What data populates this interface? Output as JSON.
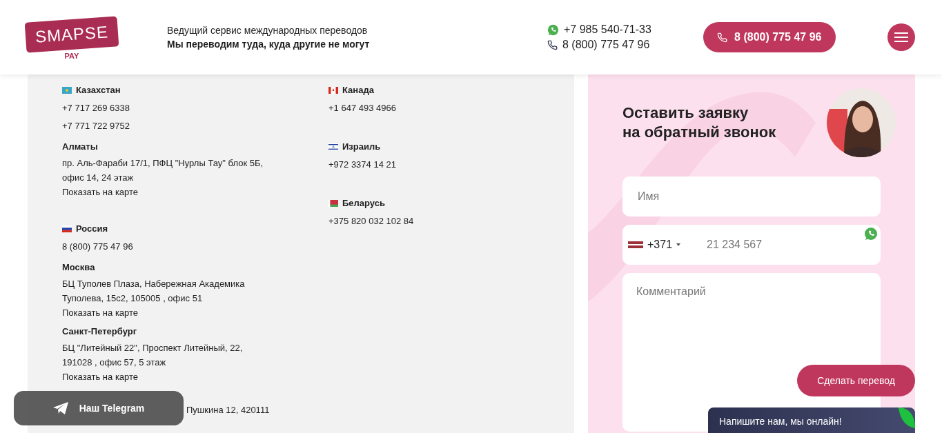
{
  "header": {
    "logo": {
      "name": "SMAPSE",
      "sub": "PAY"
    },
    "tagline": "Ведущий сервис международных переводов",
    "slogan": "Мы переводим туда, куда другие не могут",
    "phones": [
      {
        "kind": "whatsapp",
        "number": "+7 985 540-71-33"
      },
      {
        "kind": "phone",
        "number": "8 (800) 775 47 96"
      }
    ],
    "call_button": "8 (800) 775 47 96"
  },
  "contacts": [
    [
      {
        "kind": "kz",
        "country": "Казахстан",
        "phones": [
          "+7 717 269 6338",
          "+7 771 722 9752"
        ],
        "cities": [
          {
            "name": "Алматы",
            "address": "пр. Аль-Фараби 17/1, ПФЦ \"Нурлы Тау\" блок 5Б, офис 14, 24 этаж",
            "map_link": "Показать на карте"
          }
        ]
      },
      {
        "kind": "ru",
        "country": "Россия",
        "phones": [
          "8 (800) 775 47 96"
        ],
        "cities": [
          {
            "name": "Москва",
            "address": "БЦ Туполев Плаза, Набережная Академика Туполева, 15с2, 105005 , офис 51",
            "map_link": "Показать на карте"
          },
          {
            "name": "Санкт-Петербург",
            "address": "БЦ \"Литейный 22\", Проспект Литейный, 22, 191028 , офис 57, 5 этаж",
            "map_link": "Показать на карте"
          }
        ]
      }
    ],
    [
      {
        "kind": "ca",
        "country": "Канада",
        "phones": [
          "+1 647 493 4966"
        ]
      },
      {
        "kind": "il",
        "country": "Израиль",
        "phones": [
          "+972 3374 14 21"
        ]
      },
      {
        "kind": "by",
        "country": "Беларусь",
        "phones": [
          "+375 820 032 102 84"
        ]
      }
    ]
  ],
  "partial_address": "Пушкина 12, 420111",
  "form": {
    "title": "Оставить заявку\nна обратный звонок",
    "name_placeholder": "Имя",
    "phone": {
      "kind": "lv",
      "code": "+371",
      "placeholder": "21 234 567"
    },
    "comment_placeholder": "Комментарий"
  },
  "transfer_button": "Сделать перевод",
  "telegram_button": "Наш Telegram",
  "chat": {
    "text": "Напишите нам, мы онлайн!"
  }
}
